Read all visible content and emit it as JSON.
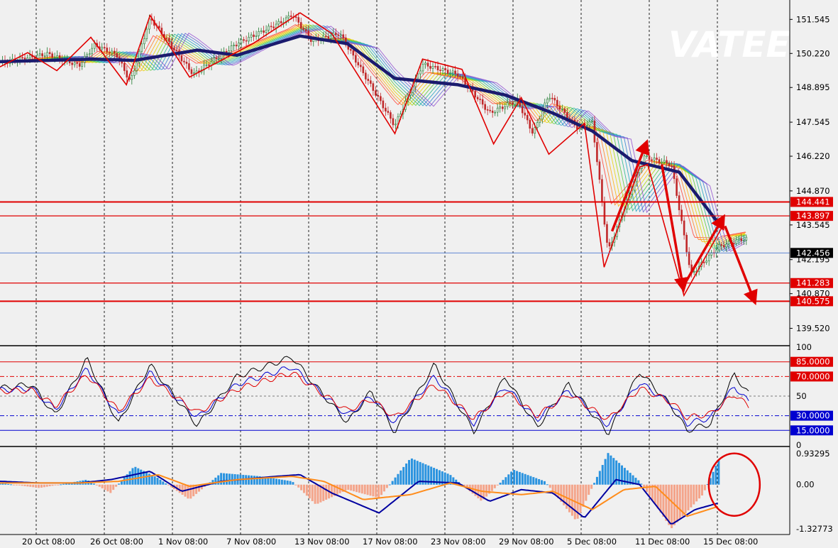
{
  "watermark": "VATEE",
  "colors": {
    "background": "#f0f0f0",
    "up_candle": "#1f7a2f",
    "down_candle": "#c0282a",
    "slow_ma": "#1b1b6e",
    "zigzag": "#e00000",
    "level_line": "#e00000",
    "current_price_line": "#4a78d0",
    "rsi_black": "#000000",
    "rsi_blue": "#0000d0",
    "rsi_red": "#e00000",
    "hist_pos": "#2a93df",
    "hist_neg": "#f4a48a",
    "macd_main": "#0000a0",
    "macd_signal": "#ff8c1a",
    "highlight_circle": "#e00000"
  },
  "chart_data": [
    {
      "type": "candlestick",
      "title": "",
      "x_labels": [
        "20 Oct 08:00",
        "26 Oct 08:00",
        "1 Nov 08:00",
        "7 Nov 08:00",
        "13 Nov 08:00",
        "17 Nov 08:00",
        "23 Nov 08:00",
        "29 Nov 08:00",
        "5 Dec 08:00",
        "11 Dec 08:00",
        "15 Dec 08:00"
      ],
      "y_tick_labels": [
        "151.545",
        "150.220",
        "148.895",
        "147.545",
        "146.220",
        "144.870",
        "143.545",
        "142.195",
        "140.870",
        "139.520"
      ],
      "ylim": [
        138.9,
        152.3
      ],
      "price_path": [
        {
          "t": 0,
          "p": 149.85
        },
        {
          "t": 0.06,
          "p": 150.2
        },
        {
          "t": 0.1,
          "p": 149.75
        },
        {
          "t": 0.12,
          "p": 150.55
        },
        {
          "t": 0.148,
          "p": 150.15
        },
        {
          "t": 0.165,
          "p": 149.1
        },
        {
          "t": 0.19,
          "p": 151.6
        },
        {
          "t": 0.245,
          "p": 149.4
        },
        {
          "t": 0.3,
          "p": 150.6
        },
        {
          "t": 0.36,
          "p": 151.5
        },
        {
          "t": 0.37,
          "p": 151.75
        },
        {
          "t": 0.395,
          "p": 150.7
        },
        {
          "t": 0.43,
          "p": 151.0
        },
        {
          "t": 0.5,
          "p": 147.4
        },
        {
          "t": 0.535,
          "p": 149.8
        },
        {
          "t": 0.58,
          "p": 149.4
        },
        {
          "t": 0.62,
          "p": 147.9
        },
        {
          "t": 0.655,
          "p": 148.4
        },
        {
          "t": 0.675,
          "p": 147.1
        },
        {
          "t": 0.695,
          "p": 148.6
        },
        {
          "t": 0.73,
          "p": 147.35
        },
        {
          "t": 0.75,
          "p": 147.55
        },
        {
          "t": 0.77,
          "p": 142.5
        },
        {
          "t": 0.815,
          "p": 146.2
        },
        {
          "t": 0.85,
          "p": 145.9
        },
        {
          "t": 0.875,
          "p": 141.6
        },
        {
          "t": 0.91,
          "p": 142.7
        },
        {
          "t": 0.94,
          "p": 143.0
        }
      ],
      "slow_ma_path": [
        {
          "t": 0,
          "p": 149.9
        },
        {
          "t": 0.12,
          "p": 150.0
        },
        {
          "t": 0.17,
          "p": 149.95
        },
        {
          "t": 0.25,
          "p": 150.35
        },
        {
          "t": 0.3,
          "p": 150.15
        },
        {
          "t": 0.38,
          "p": 150.9
        },
        {
          "t": 0.44,
          "p": 150.6
        },
        {
          "t": 0.5,
          "p": 149.25
        },
        {
          "t": 0.58,
          "p": 149.0
        },
        {
          "t": 0.64,
          "p": 148.6
        },
        {
          "t": 0.7,
          "p": 147.9
        },
        {
          "t": 0.75,
          "p": 147.2
        },
        {
          "t": 0.8,
          "p": 146.05
        },
        {
          "t": 0.86,
          "p": 145.6
        },
        {
          "t": 0.91,
          "p": 143.6
        }
      ],
      "zigzag_points": [
        {
          "t": 0.0,
          "p": 149.7
        },
        {
          "t": 0.035,
          "p": 150.25
        },
        {
          "t": 0.072,
          "p": 149.55
        },
        {
          "t": 0.115,
          "p": 150.85
        },
        {
          "t": 0.16,
          "p": 149.0
        },
        {
          "t": 0.19,
          "p": 151.7
        },
        {
          "t": 0.24,
          "p": 149.3
        },
        {
          "t": 0.32,
          "p": 150.6
        },
        {
          "t": 0.38,
          "p": 151.8
        },
        {
          "t": 0.42,
          "p": 151.0
        },
        {
          "t": 0.5,
          "p": 147.1
        },
        {
          "t": 0.535,
          "p": 150.0
        },
        {
          "t": 0.585,
          "p": 149.6
        },
        {
          "t": 0.625,
          "p": 146.7
        },
        {
          "t": 0.66,
          "p": 148.5
        },
        {
          "t": 0.695,
          "p": 146.3
        },
        {
          "t": 0.74,
          "p": 147.5
        },
        {
          "t": 0.765,
          "p": 141.9
        },
        {
          "t": 0.81,
          "p": 145.8
        },
        {
          "t": 0.82,
          "p": 145.9
        },
        {
          "t": 0.866,
          "p": 140.8
        },
        {
          "t": 0.915,
          "p": 143.5
        }
      ],
      "arrows": [
        {
          "from": {
            "t": 0.775,
            "p": 143.3
          },
          "to": {
            "t": 0.818,
            "p": 146.7
          }
        },
        {
          "from": {
            "t": 0.838,
            "p": 145.9
          },
          "to": {
            "t": 0.865,
            "p": 141.1
          }
        },
        {
          "from": {
            "t": 0.866,
            "p": 141.2
          },
          "to": {
            "t": 0.915,
            "p": 143.8
          }
        },
        {
          "from": {
            "t": 0.918,
            "p": 143.5
          },
          "to": {
            "t": 0.955,
            "p": 140.6
          }
        }
      ],
      "levels": [
        {
          "label": "144.441",
          "value": 144.441
        },
        {
          "label": "143.897",
          "value": 143.897
        },
        {
          "label": "141.283",
          "value": 141.283
        },
        {
          "label": "140.575",
          "value": 140.575
        }
      ],
      "current_price": {
        "label": "142.456",
        "value": 142.456
      }
    },
    {
      "type": "line",
      "title": "",
      "ylim": [
        0,
        100
      ],
      "y_tick_labels": [
        "100",
        "50",
        "0"
      ],
      "levels": [
        {
          "label": "85.0000",
          "value": 85
        },
        {
          "label": "70.0000",
          "value": 70
        },
        {
          "label": "30.0000",
          "value": 30
        },
        {
          "label": "15.0000",
          "value": 15
        }
      ],
      "series": [
        {
          "color": "#000000",
          "points": [
            [
              0,
              58
            ],
            [
              0.04,
              62
            ],
            [
              0.07,
              30
            ],
            [
              0.11,
              88
            ],
            [
              0.15,
              22
            ],
            [
              0.19,
              82
            ],
            [
              0.25,
              20
            ],
            [
              0.3,
              70
            ],
            [
              0.37,
              90
            ],
            [
              0.4,
              60
            ],
            [
              0.44,
              23
            ],
            [
              0.47,
              55
            ],
            [
              0.5,
              13
            ],
            [
              0.55,
              82
            ],
            [
              0.6,
              14
            ],
            [
              0.64,
              70
            ],
            [
              0.68,
              18
            ],
            [
              0.72,
              62
            ],
            [
              0.77,
              12
            ],
            [
              0.81,
              75
            ],
            [
              0.85,
              40
            ],
            [
              0.87,
              15
            ],
            [
              0.9,
              22
            ],
            [
              0.93,
              72
            ],
            [
              0.95,
              50
            ]
          ]
        },
        {
          "color": "#0000d0",
          "points": [
            [
              0,
              56
            ],
            [
              0.04,
              58
            ],
            [
              0.07,
              36
            ],
            [
              0.11,
              78
            ],
            [
              0.15,
              30
            ],
            [
              0.19,
              74
            ],
            [
              0.25,
              28
            ],
            [
              0.3,
              62
            ],
            [
              0.37,
              80
            ],
            [
              0.4,
              58
            ],
            [
              0.44,
              30
            ],
            [
              0.47,
              50
            ],
            [
              0.5,
              22
            ],
            [
              0.55,
              70
            ],
            [
              0.6,
              22
            ],
            [
              0.64,
              60
            ],
            [
              0.68,
              26
            ],
            [
              0.72,
              56
            ],
            [
              0.77,
              20
            ],
            [
              0.81,
              64
            ],
            [
              0.85,
              42
            ],
            [
              0.87,
              22
            ],
            [
              0.9,
              28
            ],
            [
              0.93,
              60
            ],
            [
              0.95,
              42
            ]
          ]
        },
        {
          "color": "#e00000",
          "points": [
            [
              0,
              55
            ],
            [
              0.04,
              56
            ],
            [
              0.07,
              40
            ],
            [
              0.11,
              72
            ],
            [
              0.15,
              35
            ],
            [
              0.19,
              68
            ],
            [
              0.25,
              33
            ],
            [
              0.3,
              57
            ],
            [
              0.37,
              74
            ],
            [
              0.4,
              57
            ],
            [
              0.44,
              35
            ],
            [
              0.47,
              47
            ],
            [
              0.5,
              28
            ],
            [
              0.55,
              62
            ],
            [
              0.6,
              27
            ],
            [
              0.64,
              55
            ],
            [
              0.68,
              30
            ],
            [
              0.72,
              52
            ],
            [
              0.77,
              26
            ],
            [
              0.81,
              58
            ],
            [
              0.85,
              44
            ],
            [
              0.87,
              28
            ],
            [
              0.9,
              32
            ],
            [
              0.93,
              52
            ],
            [
              0.95,
              38
            ]
          ]
        }
      ]
    },
    {
      "type": "bar",
      "title": "",
      "ylim": [
        -1.32773,
        0.93295
      ],
      "y_tick_labels": [
        "0.93295",
        "0.00",
        "-1.32773"
      ],
      "histogram": [
        {
          "t": 0.0,
          "v": 0.05
        },
        {
          "t": 0.05,
          "v": -0.1
        },
        {
          "t": 0.08,
          "v": 0.02
        },
        {
          "t": 0.11,
          "v": 0.15
        },
        {
          "t": 0.14,
          "v": -0.25
        },
        {
          "t": 0.17,
          "v": 0.55
        },
        {
          "t": 0.2,
          "v": 0.2
        },
        {
          "t": 0.24,
          "v": -0.45
        },
        {
          "t": 0.28,
          "v": 0.35
        },
        {
          "t": 0.33,
          "v": 0.25
        },
        {
          "t": 0.37,
          "v": 0.1
        },
        {
          "t": 0.4,
          "v": -0.6
        },
        {
          "t": 0.44,
          "v": -0.15
        },
        {
          "t": 0.48,
          "v": -0.4
        },
        {
          "t": 0.52,
          "v": 0.8
        },
        {
          "t": 0.57,
          "v": 0.3
        },
        {
          "t": 0.61,
          "v": -0.5
        },
        {
          "t": 0.65,
          "v": 0.45
        },
        {
          "t": 0.69,
          "v": 0.1
        },
        {
          "t": 0.73,
          "v": -1.1
        },
        {
          "t": 0.77,
          "v": 0.95
        },
        {
          "t": 0.81,
          "v": 0.1
        },
        {
          "t": 0.85,
          "v": -1.32
        },
        {
          "t": 0.89,
          "v": -0.3
        },
        {
          "t": 0.91,
          "v": 0.75
        }
      ],
      "series": [
        {
          "color": "#0000a0",
          "points": [
            [
              0,
              0.1
            ],
            [
              0.05,
              0.05
            ],
            [
              0.1,
              0.05
            ],
            [
              0.14,
              0.15
            ],
            [
              0.19,
              0.4
            ],
            [
              0.23,
              -0.2
            ],
            [
              0.28,
              0.1
            ],
            [
              0.35,
              0.25
            ],
            [
              0.38,
              0.3
            ],
            [
              0.42,
              -0.25
            ],
            [
              0.48,
              -0.85
            ],
            [
              0.53,
              0.1
            ],
            [
              0.58,
              0.05
            ],
            [
              0.62,
              -0.5
            ],
            [
              0.66,
              -0.15
            ],
            [
              0.7,
              -0.25
            ],
            [
              0.74,
              -1.0
            ],
            [
              0.78,
              0.15
            ],
            [
              0.81,
              0.0
            ],
            [
              0.85,
              -1.2
            ],
            [
              0.88,
              -0.75
            ],
            [
              0.91,
              -0.55
            ]
          ]
        },
        {
          "color": "#ff8c1a",
          "points": [
            [
              0,
              0.05
            ],
            [
              0.05,
              0.05
            ],
            [
              0.1,
              0.05
            ],
            [
              0.15,
              0.1
            ],
            [
              0.2,
              0.3
            ],
            [
              0.24,
              -0.05
            ],
            [
              0.3,
              0.15
            ],
            [
              0.37,
              0.25
            ],
            [
              0.41,
              0.1
            ],
            [
              0.46,
              -0.45
            ],
            [
              0.52,
              -0.3
            ],
            [
              0.57,
              0.05
            ],
            [
              0.61,
              -0.2
            ],
            [
              0.66,
              -0.3
            ],
            [
              0.7,
              -0.2
            ],
            [
              0.75,
              -0.75
            ],
            [
              0.79,
              -0.15
            ],
            [
              0.83,
              -0.05
            ],
            [
              0.87,
              -0.95
            ],
            [
              0.91,
              -0.65
            ]
          ]
        }
      ],
      "highlight": {
        "t": 0.91,
        "v": 0.0
      }
    }
  ]
}
